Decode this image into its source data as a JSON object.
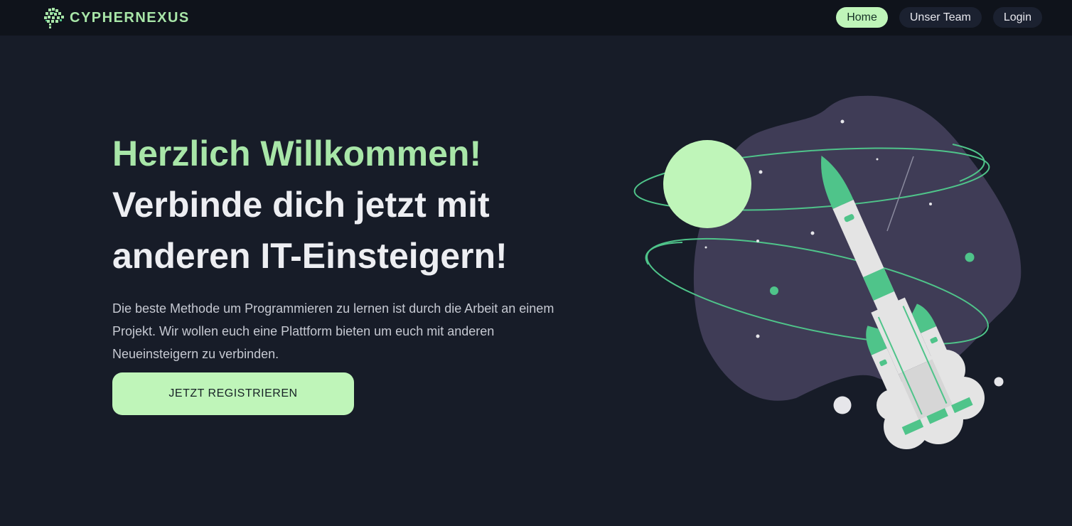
{
  "navbar": {
    "logo_icon": "brain-pixel-icon",
    "brand": "CYPHERNEXUS",
    "links": [
      {
        "label": "Home",
        "active": true
      },
      {
        "label": "Unser Team",
        "active": false
      },
      {
        "label": "Login",
        "active": false
      }
    ]
  },
  "hero": {
    "greeting": "Herzlich Willkommen!",
    "headline_line1": "Verbinde dich jetzt mit",
    "headline_line2": "anderen IT-Einsteigern!",
    "description": "Die beste Methode um Programmieren zu lernen ist durch die Arbeit an einem Projekt. Wir wollen euch eine Plattform bieten um euch mit anderen Neueinsteigern zu verbinden.",
    "cta_label": "JETZT REGISTRIEREN"
  },
  "illustration": {
    "icon": "rocket-planet-illustration"
  },
  "colors": {
    "background": "#171c28",
    "navbar": "#0f131b",
    "accent": "#bff5b9",
    "accent_text": "#a8e6a8",
    "green": "#4fc48a",
    "blob": "#3f3c56"
  }
}
